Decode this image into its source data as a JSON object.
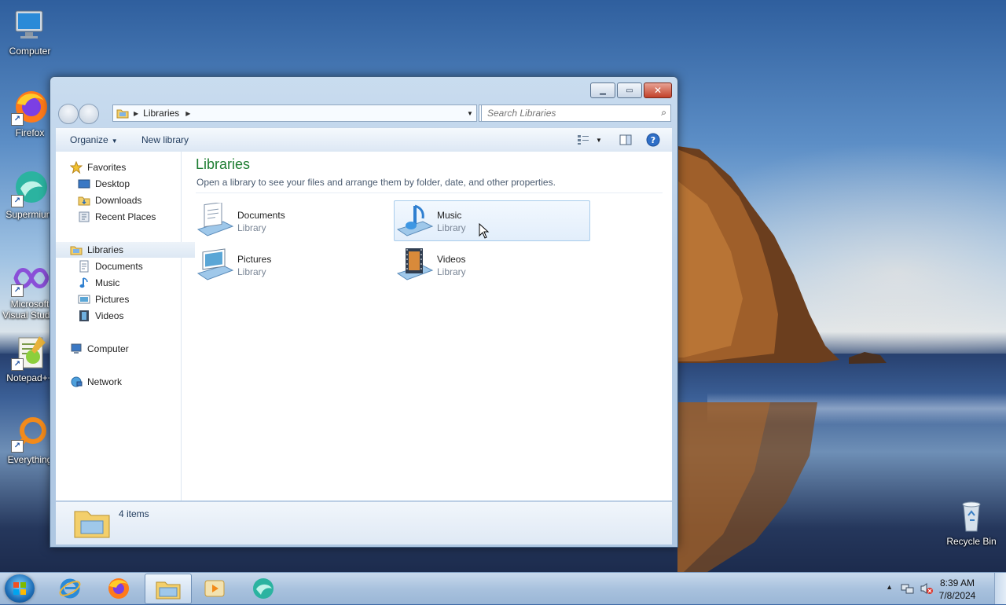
{
  "desktop": {
    "icons": [
      {
        "label": "Computer"
      },
      {
        "label": "Firefox"
      },
      {
        "label": "Supermium"
      },
      {
        "label_line1": "Microsoft",
        "label_line2": "Visual Studio"
      },
      {
        "label": "Notepad++"
      },
      {
        "label": "Everything"
      },
      {
        "label": "Recycle Bin"
      }
    ]
  },
  "window": {
    "address": {
      "crumbs": [
        "Libraries"
      ]
    },
    "search": {
      "placeholder": "Search Libraries"
    },
    "toolbar": {
      "organize": "Organize",
      "new_library": "New library"
    },
    "navpane": {
      "favorites": "Favorites",
      "favorites_items": [
        "Desktop",
        "Downloads",
        "Recent Places"
      ],
      "libraries": "Libraries",
      "libraries_items": [
        "Documents",
        "Music",
        "Pictures",
        "Videos"
      ],
      "computer": "Computer",
      "network": "Network"
    },
    "content": {
      "title": "Libraries",
      "subtitle": "Open a library to see your files and arrange them by folder, date, and other properties.",
      "libraries": [
        {
          "name": "Documents",
          "kind": "Library"
        },
        {
          "name": "Music",
          "kind": "Library"
        },
        {
          "name": "Pictures",
          "kind": "Library"
        },
        {
          "name": "Videos",
          "kind": "Library"
        }
      ]
    },
    "details": {
      "count": "4 items"
    }
  },
  "taskbar": {
    "time": "8:39 AM",
    "date": "7/8/2024"
  },
  "colors": {
    "accent_title": "#1e7d32",
    "taskbar": "#a9c2de",
    "selection": "#a9cdec"
  }
}
